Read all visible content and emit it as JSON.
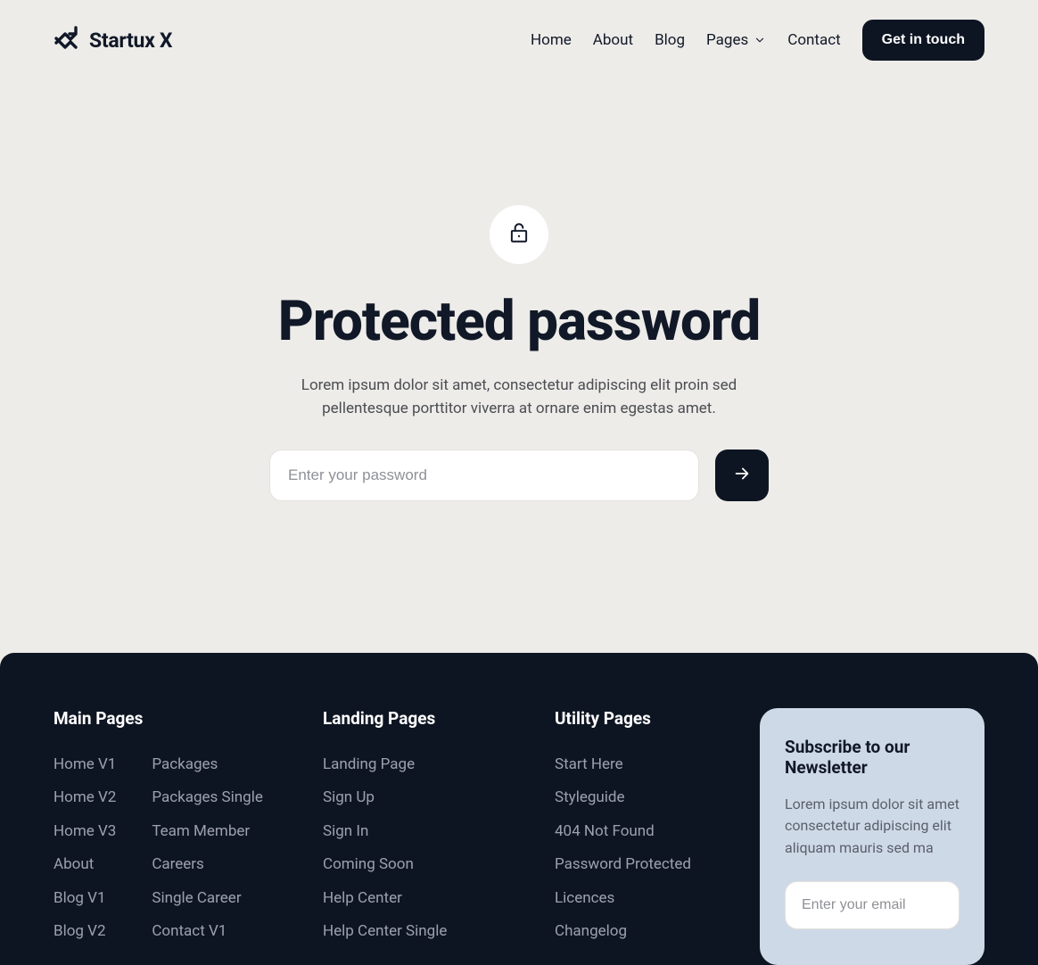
{
  "header": {
    "logo_text": "Startux X",
    "nav": {
      "home": "Home",
      "about": "About",
      "blog": "Blog",
      "pages": "Pages",
      "contact": "Contact"
    },
    "cta": "Get in touch"
  },
  "hero": {
    "title": "Protected password",
    "subtitle": "Lorem ipsum dolor sit amet, consectetur adipiscing elit proin sed pellentesque porttitor viverra at ornare enim egestas amet.",
    "password_placeholder": "Enter your password"
  },
  "footer": {
    "main": {
      "title": "Main Pages",
      "colA": [
        "Home V1",
        "Home V2",
        "Home V3",
        "About",
        "Blog V1",
        "Blog V2"
      ],
      "colB": [
        "Packages",
        "Packages Single",
        "Team Member",
        "Careers",
        "Single Career",
        "Contact V1"
      ]
    },
    "landing": {
      "title": "Landing Pages",
      "links": [
        "Landing Page",
        "Sign Up",
        "Sign In",
        "Coming Soon",
        "Help Center",
        "Help Center Single"
      ]
    },
    "utility": {
      "title": "Utility Pages",
      "links": [
        "Start Here",
        "Styleguide",
        "404 Not Found",
        "Password Protected",
        "Licences",
        "Changelog"
      ]
    },
    "newsletter": {
      "title": "Subscribe to our Newsletter",
      "subtitle": "Lorem ipsum dolor sit amet consectetur adipiscing elit aliquam mauris sed ma",
      "email_placeholder": "Enter your email"
    }
  }
}
